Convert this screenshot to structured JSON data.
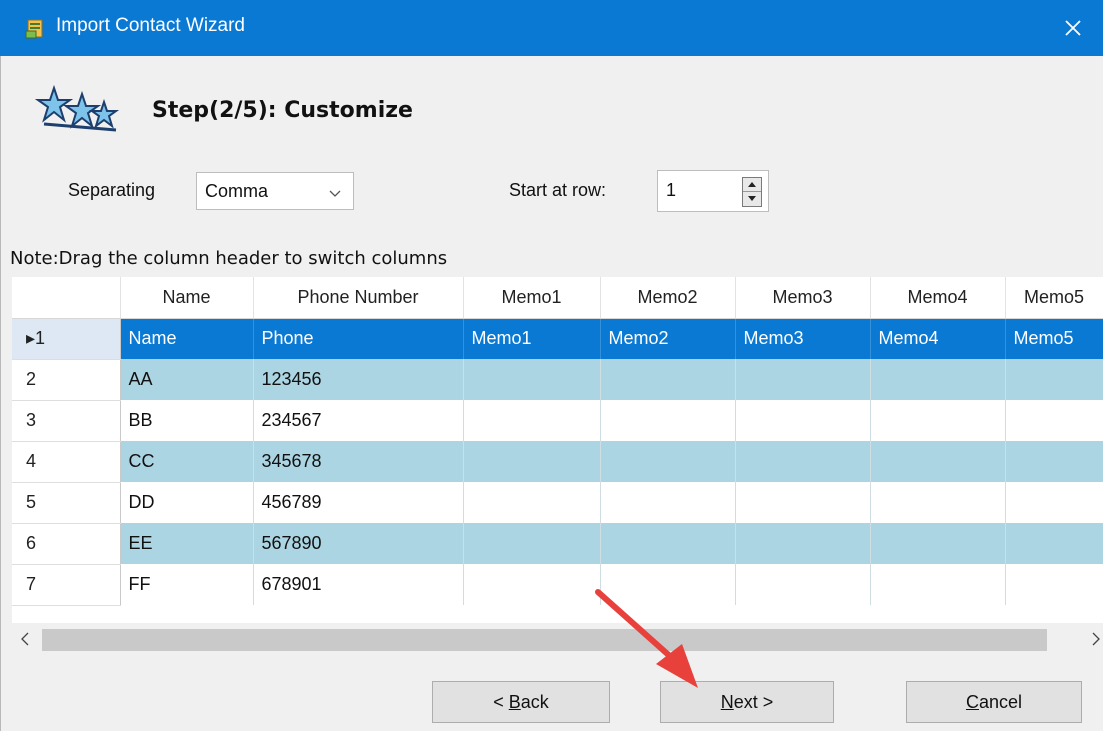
{
  "window": {
    "title": "Import Contact Wizard"
  },
  "step": {
    "title": "Step(2/5): Customize"
  },
  "separating": {
    "label": "Separating",
    "value": "Comma"
  },
  "start_row": {
    "label": "Start at row:",
    "value": "1"
  },
  "note": "Note:Drag the column header to switch columns",
  "grid": {
    "headers": [
      "Name",
      "Phone Number",
      "Memo1",
      "Memo2",
      "Memo3",
      "Memo4",
      "Memo5"
    ],
    "rows": [
      {
        "num": "1",
        "marker": "▸",
        "cells": [
          "Name",
          "Phone",
          "Memo1",
          "Memo2",
          "Memo3",
          "Memo4",
          "Memo5"
        ]
      },
      {
        "num": "2",
        "cells": [
          "AA",
          "123456",
          "",
          "",
          "",
          "",
          ""
        ]
      },
      {
        "num": "3",
        "cells": [
          "BB",
          "234567",
          "",
          "",
          "",
          "",
          ""
        ]
      },
      {
        "num": "4",
        "cells": [
          "CC",
          "345678",
          "",
          "",
          "",
          "",
          ""
        ]
      },
      {
        "num": "5",
        "cells": [
          "DD",
          "456789",
          "",
          "",
          "",
          "",
          ""
        ]
      },
      {
        "num": "6",
        "cells": [
          "EE",
          "567890",
          "",
          "",
          "",
          "",
          ""
        ]
      },
      {
        "num": "7",
        "cells": [
          "FF",
          "678901",
          "",
          "",
          "",
          "",
          ""
        ]
      }
    ]
  },
  "buttons": {
    "back": {
      "prefix": "< ",
      "accel": "B",
      "rest": "ack"
    },
    "next": {
      "accel": "N",
      "rest": "ext >"
    },
    "cancel": {
      "accel": "C",
      "rest": "ancel"
    }
  },
  "colors": {
    "titlebar": "#0a79d4",
    "selected_row": "#0a79d4",
    "stripe_row": "#acd5e3",
    "annotation_arrow": "#e8413c"
  }
}
